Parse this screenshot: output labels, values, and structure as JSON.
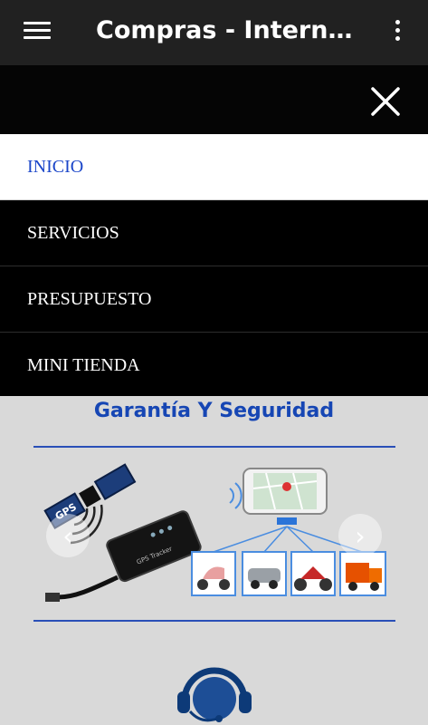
{
  "appbar": {
    "title": "Compras - Internacionales",
    "menu_icon": "hamburger-icon",
    "more_icon": "more-vertical-icon"
  },
  "drawer": {
    "close_icon": "close-icon",
    "items": [
      {
        "label": "INICIO",
        "active": true
      },
      {
        "label": "SERVICIOS",
        "active": false
      },
      {
        "label": "PRESUPUESTO",
        "active": false
      },
      {
        "label": "MINI TIENDA",
        "active": false
      }
    ]
  },
  "content": {
    "section_title": "Garantía Y Seguridad",
    "carousel": {
      "prev_icon": "chevron-left-icon",
      "next_icon": "chevron-right-icon",
      "gps_label": "GPS",
      "device_label": "GPS Tracker"
    },
    "support_icon": "headset-support-icon"
  },
  "colors": {
    "appbar": "#212121",
    "menu_bg": "#000000",
    "active_text": "#1b46c9",
    "title_blue": "#1646b4",
    "content_bg": "#d9d9d9"
  }
}
